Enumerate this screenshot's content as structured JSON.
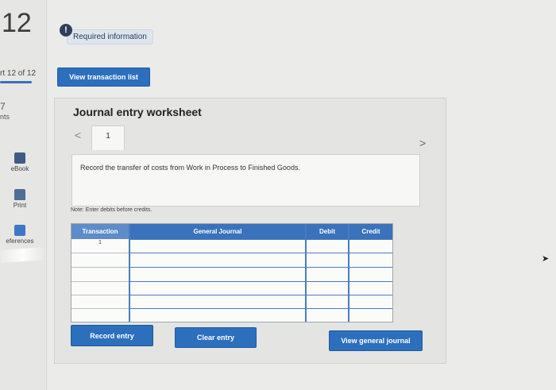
{
  "sidebar": {
    "question_number": "12",
    "part_label": "rt 12 of 12",
    "points_value": "7",
    "points_label": "nts",
    "tools": [
      {
        "label": "eBook",
        "icon": "ebook-icon"
      },
      {
        "label": "Print",
        "icon": "print-icon"
      },
      {
        "label": "eferences",
        "icon": "references-icon"
      }
    ]
  },
  "header": {
    "info_icon_text": "!",
    "required_info_label": "Required information"
  },
  "buttons": {
    "view_transaction_list": "View transaction list",
    "record_entry": "Record entry",
    "clear_entry": "Clear entry",
    "view_general_journal": "View general journal"
  },
  "worksheet": {
    "title": "Journal entry worksheet",
    "prev_arrow": "<",
    "next_arrow": ">",
    "current_tab": "1",
    "description": "Record the transfer of costs from Work in Process to Finished Goods.",
    "note": "Note: Enter debits before credits."
  },
  "journal_table": {
    "columns": [
      "Transaction",
      "General Journal",
      "Debit",
      "Credit"
    ],
    "rows": [
      {
        "transaction": "1",
        "account": "",
        "debit": "",
        "credit": ""
      },
      {
        "transaction": "",
        "account": "",
        "debit": "",
        "credit": ""
      },
      {
        "transaction": "",
        "account": "",
        "debit": "",
        "credit": ""
      },
      {
        "transaction": "",
        "account": "",
        "debit": "",
        "credit": ""
      },
      {
        "transaction": "",
        "account": "",
        "debit": "",
        "credit": ""
      },
      {
        "transaction": "",
        "account": "",
        "debit": "",
        "credit": ""
      }
    ]
  },
  "colors": {
    "accent": "#2c6fbd",
    "header_blue": "#3a72bb",
    "info_icon": "#2f3e5c"
  }
}
